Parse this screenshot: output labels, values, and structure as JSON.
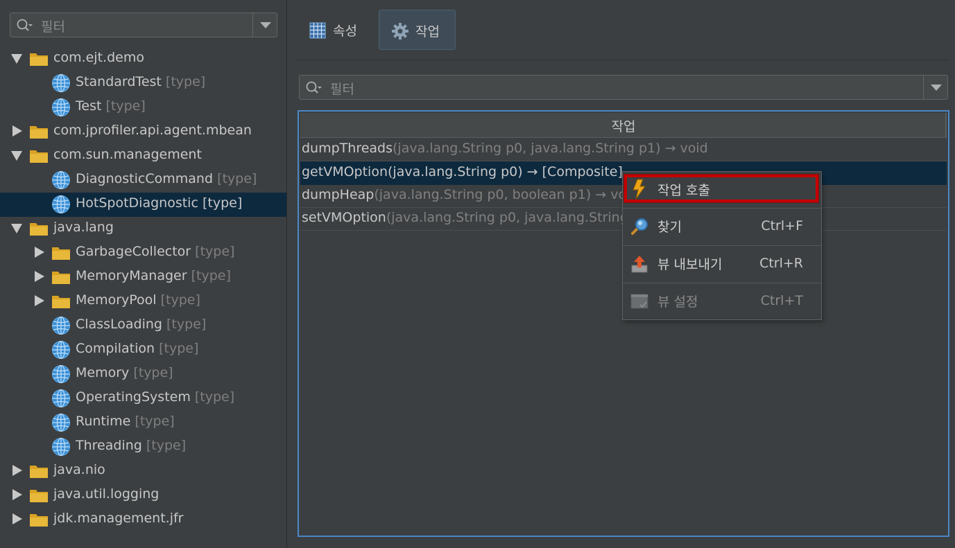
{
  "left_panel": {
    "filter": {
      "placeholder": "필터",
      "search_icon": "search-icon",
      "dropdown_icon": "chevron-down-icon"
    },
    "tree": [
      {
        "label": "com.ejt.demo",
        "type_suffix": "",
        "kind": "folder",
        "expanded": true,
        "level": 0
      },
      {
        "label": "StandardTest",
        "type_suffix": "[type]",
        "kind": "mbean",
        "level": 1
      },
      {
        "label": "Test",
        "type_suffix": "[type]",
        "kind": "mbean",
        "level": 1
      },
      {
        "label": "com.jprofiler.api.agent.mbean",
        "type_suffix": "",
        "kind": "folder",
        "expanded": false,
        "level": 0
      },
      {
        "label": "com.sun.management",
        "type_suffix": "",
        "kind": "folder",
        "expanded": true,
        "level": 0
      },
      {
        "label": "DiagnosticCommand",
        "type_suffix": "[type]",
        "kind": "mbean",
        "level": 1
      },
      {
        "label": "HotSpotDiagnostic",
        "type_suffix": "[type]",
        "kind": "mbean",
        "level": 1,
        "selected": true
      },
      {
        "label": "java.lang",
        "type_suffix": "",
        "kind": "folder",
        "expanded": true,
        "level": 0
      },
      {
        "label": "GarbageCollector",
        "type_suffix": "[type]",
        "kind": "folder",
        "expanded": false,
        "level": 1
      },
      {
        "label": "MemoryManager",
        "type_suffix": "[type]",
        "kind": "folder",
        "expanded": false,
        "level": 1
      },
      {
        "label": "MemoryPool",
        "type_suffix": "[type]",
        "kind": "folder",
        "expanded": false,
        "level": 1
      },
      {
        "label": "ClassLoading",
        "type_suffix": "[type]",
        "kind": "mbean",
        "level": 1
      },
      {
        "label": "Compilation",
        "type_suffix": "[type]",
        "kind": "mbean",
        "level": 1
      },
      {
        "label": "Memory",
        "type_suffix": "[type]",
        "kind": "mbean",
        "level": 1
      },
      {
        "label": "OperatingSystem",
        "type_suffix": "[type]",
        "kind": "mbean",
        "level": 1
      },
      {
        "label": "Runtime",
        "type_suffix": "[type]",
        "kind": "mbean",
        "level": 1
      },
      {
        "label": "Threading",
        "type_suffix": "[type]",
        "kind": "mbean",
        "level": 1
      },
      {
        "label": "java.nio",
        "type_suffix": "",
        "kind": "folder",
        "expanded": false,
        "level": 0
      },
      {
        "label": "java.util.logging",
        "type_suffix": "",
        "kind": "folder",
        "expanded": false,
        "level": 0
      },
      {
        "label": "jdk.management.jfr",
        "type_suffix": "",
        "kind": "folder",
        "expanded": false,
        "level": 0
      }
    ]
  },
  "tabs": [
    {
      "label": "속성",
      "icon": "table-icon",
      "active": false
    },
    {
      "label": "작업",
      "icon": "gear-icon",
      "active": true
    }
  ],
  "ops_filter": {
    "placeholder": "필터"
  },
  "ops_table": {
    "header": "작업",
    "rows": [
      {
        "name": "dumpThreads",
        "signature": "(java.lang.String p0, java.lang.String p1) → void",
        "selected": false
      },
      {
        "name": "getVMOption",
        "signature": "(java.lang.String p0) → [Composite]",
        "selected": true
      },
      {
        "name": "dumpHeap",
        "signature": "(java.lang.String p0, boolean p1) → void",
        "selected": false
      },
      {
        "name": "setVMOption",
        "signature": "(java.lang.String p0, java.lang.String p1) → void",
        "selected": false
      }
    ]
  },
  "context_menu": {
    "items": [
      {
        "label": "작업 호출",
        "shortcut": "",
        "icon": "lightning-icon",
        "highlighted": true,
        "enabled": true
      },
      {
        "label": "찾기",
        "shortcut": "Ctrl+F",
        "icon": "magnifier-icon",
        "enabled": true
      },
      {
        "label": "뷰 내보내기",
        "shortcut": "Ctrl+R",
        "icon": "export-icon",
        "enabled": true
      },
      {
        "label": "뷰 설정",
        "shortcut": "Ctrl+T",
        "icon": "view-settings-icon",
        "enabled": false
      }
    ]
  },
  "colors": {
    "selection": "#0d293e",
    "focus_border": "#4a88c7",
    "highlight_box": "#c40000",
    "background": "#3c3f41"
  }
}
